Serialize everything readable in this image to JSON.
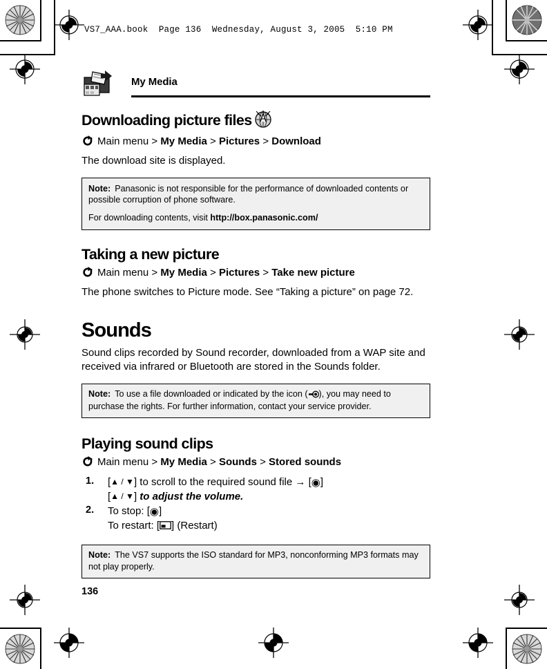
{
  "print_header": {
    "stamp": "VS7_AAA.book  Page 136  Wednesday, August 3, 2005  5:10 PM"
  },
  "running_head": {
    "title": "My Media",
    "icon": "my-media-folder-icon"
  },
  "sections": {
    "downloading": {
      "heading": "Downloading picture files",
      "heading_icon": "globe-antenna-icon",
      "nav_icon": "curved-arrow-icon",
      "nav": {
        "root": "Main menu",
        "sep": ">",
        "crumb1": "My Media",
        "crumb2": "Pictures",
        "crumb3": "Download"
      },
      "body": "The download site is displayed.",
      "note": {
        "label": "Note:",
        "line1": "Panasonic is not responsible for the performance of downloaded contents or possible corruption of phone software.",
        "line2_pre": "For downloading contents, visit ",
        "line2_url": "http://box.panasonic.com/"
      }
    },
    "taking_picture": {
      "heading": "Taking a new picture",
      "nav_icon": "curved-arrow-icon",
      "nav": {
        "root": "Main menu",
        "sep": ">",
        "crumb1": "My Media",
        "crumb2": "Pictures",
        "crumb3": "Take new picture"
      },
      "body": "The phone switches to Picture mode. See “Taking a picture” on page 72."
    },
    "sounds": {
      "heading": "Sounds",
      "body": "Sound clips recorded by Sound recorder, downloaded from a WAP site and received via infrared or Bluetooth are stored in the Sounds folder.",
      "note": {
        "label": "Note:",
        "pre_icon": "To use a file downloaded or indicated by the icon (",
        "icon": "key-rights-icon",
        "post_icon": "), you may need to purchase the rights. For further information, contact your service provider."
      }
    },
    "playing_sound_clips": {
      "heading": "Playing sound clips",
      "nav_icon": "curved-arrow-icon",
      "nav": {
        "root": "Main menu",
        "sep": ">",
        "crumb1": "My Media",
        "crumb2": "Sounds",
        "crumb3": "Stored sounds"
      },
      "steps": [
        {
          "num": "1.",
          "line1_pre": "[",
          "line1_keys": "▲ / ▼",
          "line1_mid": "] to scroll to the required sound file → [",
          "line1_center": "◉",
          "line1_post": "]",
          "line2_pre": "[",
          "line2_keys": "▲ / ▼",
          "line2_mid": "] ",
          "line2_italic": "to adjust the volume."
        },
        {
          "num": "2.",
          "stop_pre": "To stop: [",
          "stop_key": "◉",
          "stop_post": "]",
          "restart_pre": "To restart: [",
          "restart_key": "soft-key-icon",
          "restart_mid": "] (",
          "restart_label": "Restart",
          "restart_post": ")"
        }
      ],
      "note": {
        "label": "Note:",
        "text": "The VS7 supports the ISO standard for MP3, nonconforming MP3 formats may not play properly."
      }
    }
  },
  "footer": {
    "page_number": "136"
  }
}
